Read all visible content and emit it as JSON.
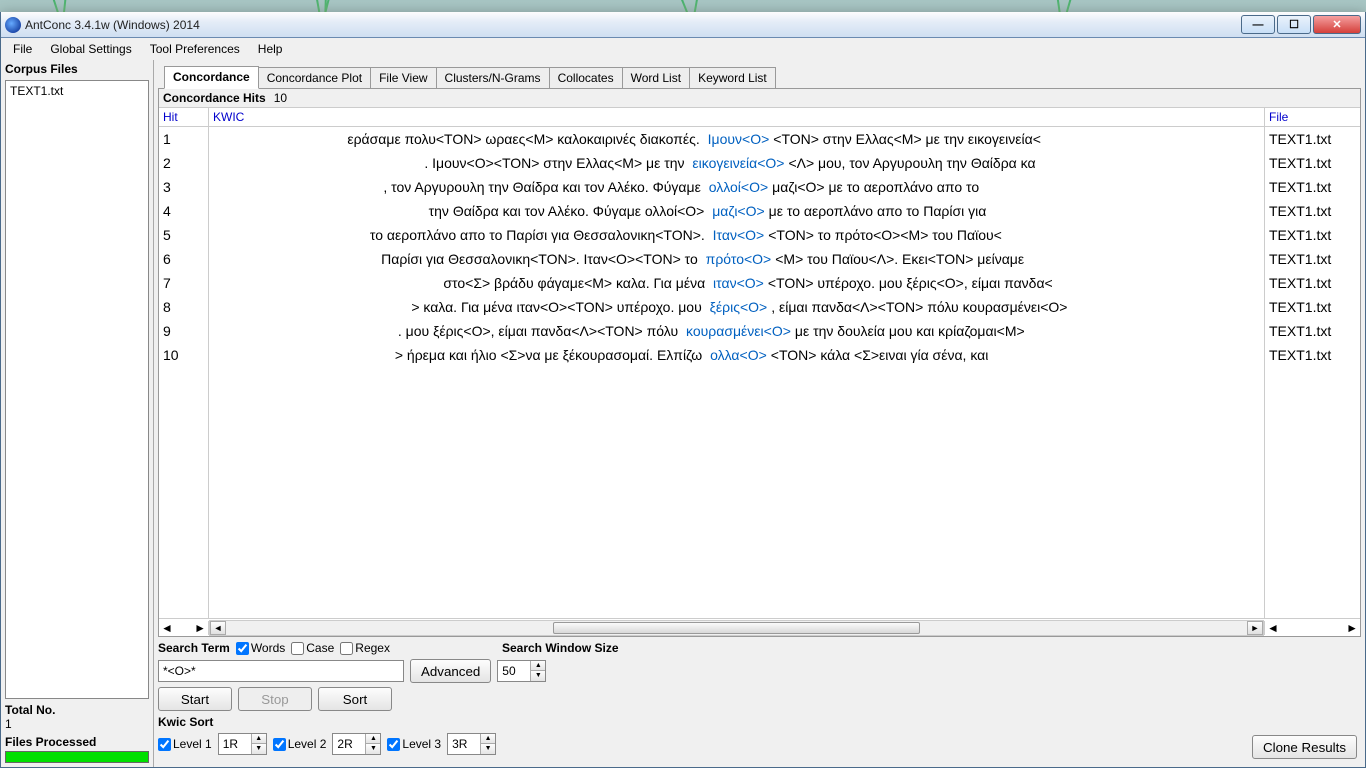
{
  "window": {
    "title": "AntConc 3.4.1w (Windows) 2014"
  },
  "menu": {
    "file": "File",
    "global": "Global Settings",
    "tool": "Tool Preferences",
    "help": "Help"
  },
  "left": {
    "header": "Corpus Files",
    "files": [
      "TEXT1.txt"
    ],
    "total_label": "Total No.",
    "total_value": "1",
    "processed_label": "Files Processed"
  },
  "tabs": [
    "Concordance",
    "Concordance Plot",
    "File View",
    "Clusters/N-Grams",
    "Collocates",
    "Word List",
    "Keyword List"
  ],
  "active_tab": 0,
  "hits": {
    "label": "Concordance Hits",
    "value": "10"
  },
  "columns": {
    "hit": "Hit",
    "kwic": "KWIC",
    "file": "File"
  },
  "rows": [
    {
      "n": "1",
      "left": "εράσαμε πολυ<ΤΟΝ> ωραες<Μ> καλοκαιρινές διακοπές.",
      "key": " Ιμουν<Ο>",
      "right": "<ΤΟΝ> στην Ελλας<Μ> με την εικογεινεία<",
      "file": "TEXT1.txt"
    },
    {
      "n": "2",
      "left": ". Ιμουν<Ο><ΤΟΝ> στην Ελλας<Μ> με την",
      "key": " εικογεινεία<Ο>",
      "right": "<Λ> μου, τον Αργυρουλη την Θαίδρα κα",
      "file": "TEXT1.txt"
    },
    {
      "n": "3",
      "left": ", τον Αργυρουλη την Θαίδρα και τον Αλέκο. Φύγαμε",
      "key": " ολλοί<Ο>",
      "right": " μαζι<Ο> με το αεροπλάνο απο το",
      "file": "TEXT1.txt"
    },
    {
      "n": "4",
      "left": "την Θαίδρα και τον Αλέκο. Φύγαμε ολλοί<Ο>",
      "key": " μαζι<Ο>",
      " right": "",
      "right": " με το αεροπλάνο απο το Παρίσι για",
      "file": "TEXT1.txt"
    },
    {
      "n": "5",
      "left": "το αεροπλάνο απο το Παρίσι για Θεσσαλονικη<ΤΟΝ>.",
      "key": " Ιταν<Ο>",
      "right": "<ΤΟΝ> το πρότο<Ο><Μ> του Παϊου<",
      "file": "TEXT1.txt"
    },
    {
      "n": "6",
      "left": "Παρίσι για Θεσσαλονικη<ΤΟΝ>. Ιταν<Ο><ΤΟΝ> το",
      "key": " πρότο<Ο>",
      "right": "<Μ> του Παϊου<Λ>. Εκει<ΤΟΝ> μείναμε",
      "file": "TEXT1.txt"
    },
    {
      "n": "7",
      "left": "στο<Σ> βράδυ φάγαμε<Μ> καλα. Για μένα",
      "key": " ιταν<Ο>",
      "right": "<ΤΟΝ> υπέροχο. μου ξέρις<Ο>, είμαι πανδα<",
      "file": "TEXT1.txt"
    },
    {
      "n": "8",
      "left": "> καλα. Για μένα ιταν<Ο><ΤΟΝ> υπέροχο. μου",
      "key": " ξέρις<Ο>",
      "right": ", είμαι πανδα<Λ><ΤΟΝ> πόλυ κουρασμένει<Ο>",
      "file": "TEXT1.txt"
    },
    {
      "n": "9",
      "left": ". μου ξέρις<Ο>, είμαι πανδα<Λ><ΤΟΝ> πόλυ",
      "key": " κουρασμένει<Ο>",
      "right": " με την δουλεία μου και κρίαζομαι<Μ>",
      "file": "TEXT1.txt"
    },
    {
      "n": "10",
      "left": "> ήρεμα και ήλιο <Σ>να με ξέκουρασομαί. Ελπίζω",
      "key": " ολλα<Ο>",
      "right": "<ΤΟΝ> κάλα <Σ>ειναι γία σένα, και",
      "file": "TEXT1.txt"
    }
  ],
  "search": {
    "term_label": "Search Term",
    "words_label": "Words",
    "case_label": "Case",
    "regex_label": "Regex",
    "value": "*<O>*",
    "advanced": "Advanced",
    "window_label": "Search Window Size",
    "window_value": "50",
    "start": "Start",
    "stop": "Stop",
    "sort": "Sort"
  },
  "kwicsort": {
    "label": "Kwic Sort",
    "l1_label": "Level 1",
    "l1_value": "1R",
    "l2_label": "Level 2",
    "l2_value": "2R",
    "l3_label": "Level 3",
    "l3_value": "3R"
  },
  "clone": "Clone Results"
}
